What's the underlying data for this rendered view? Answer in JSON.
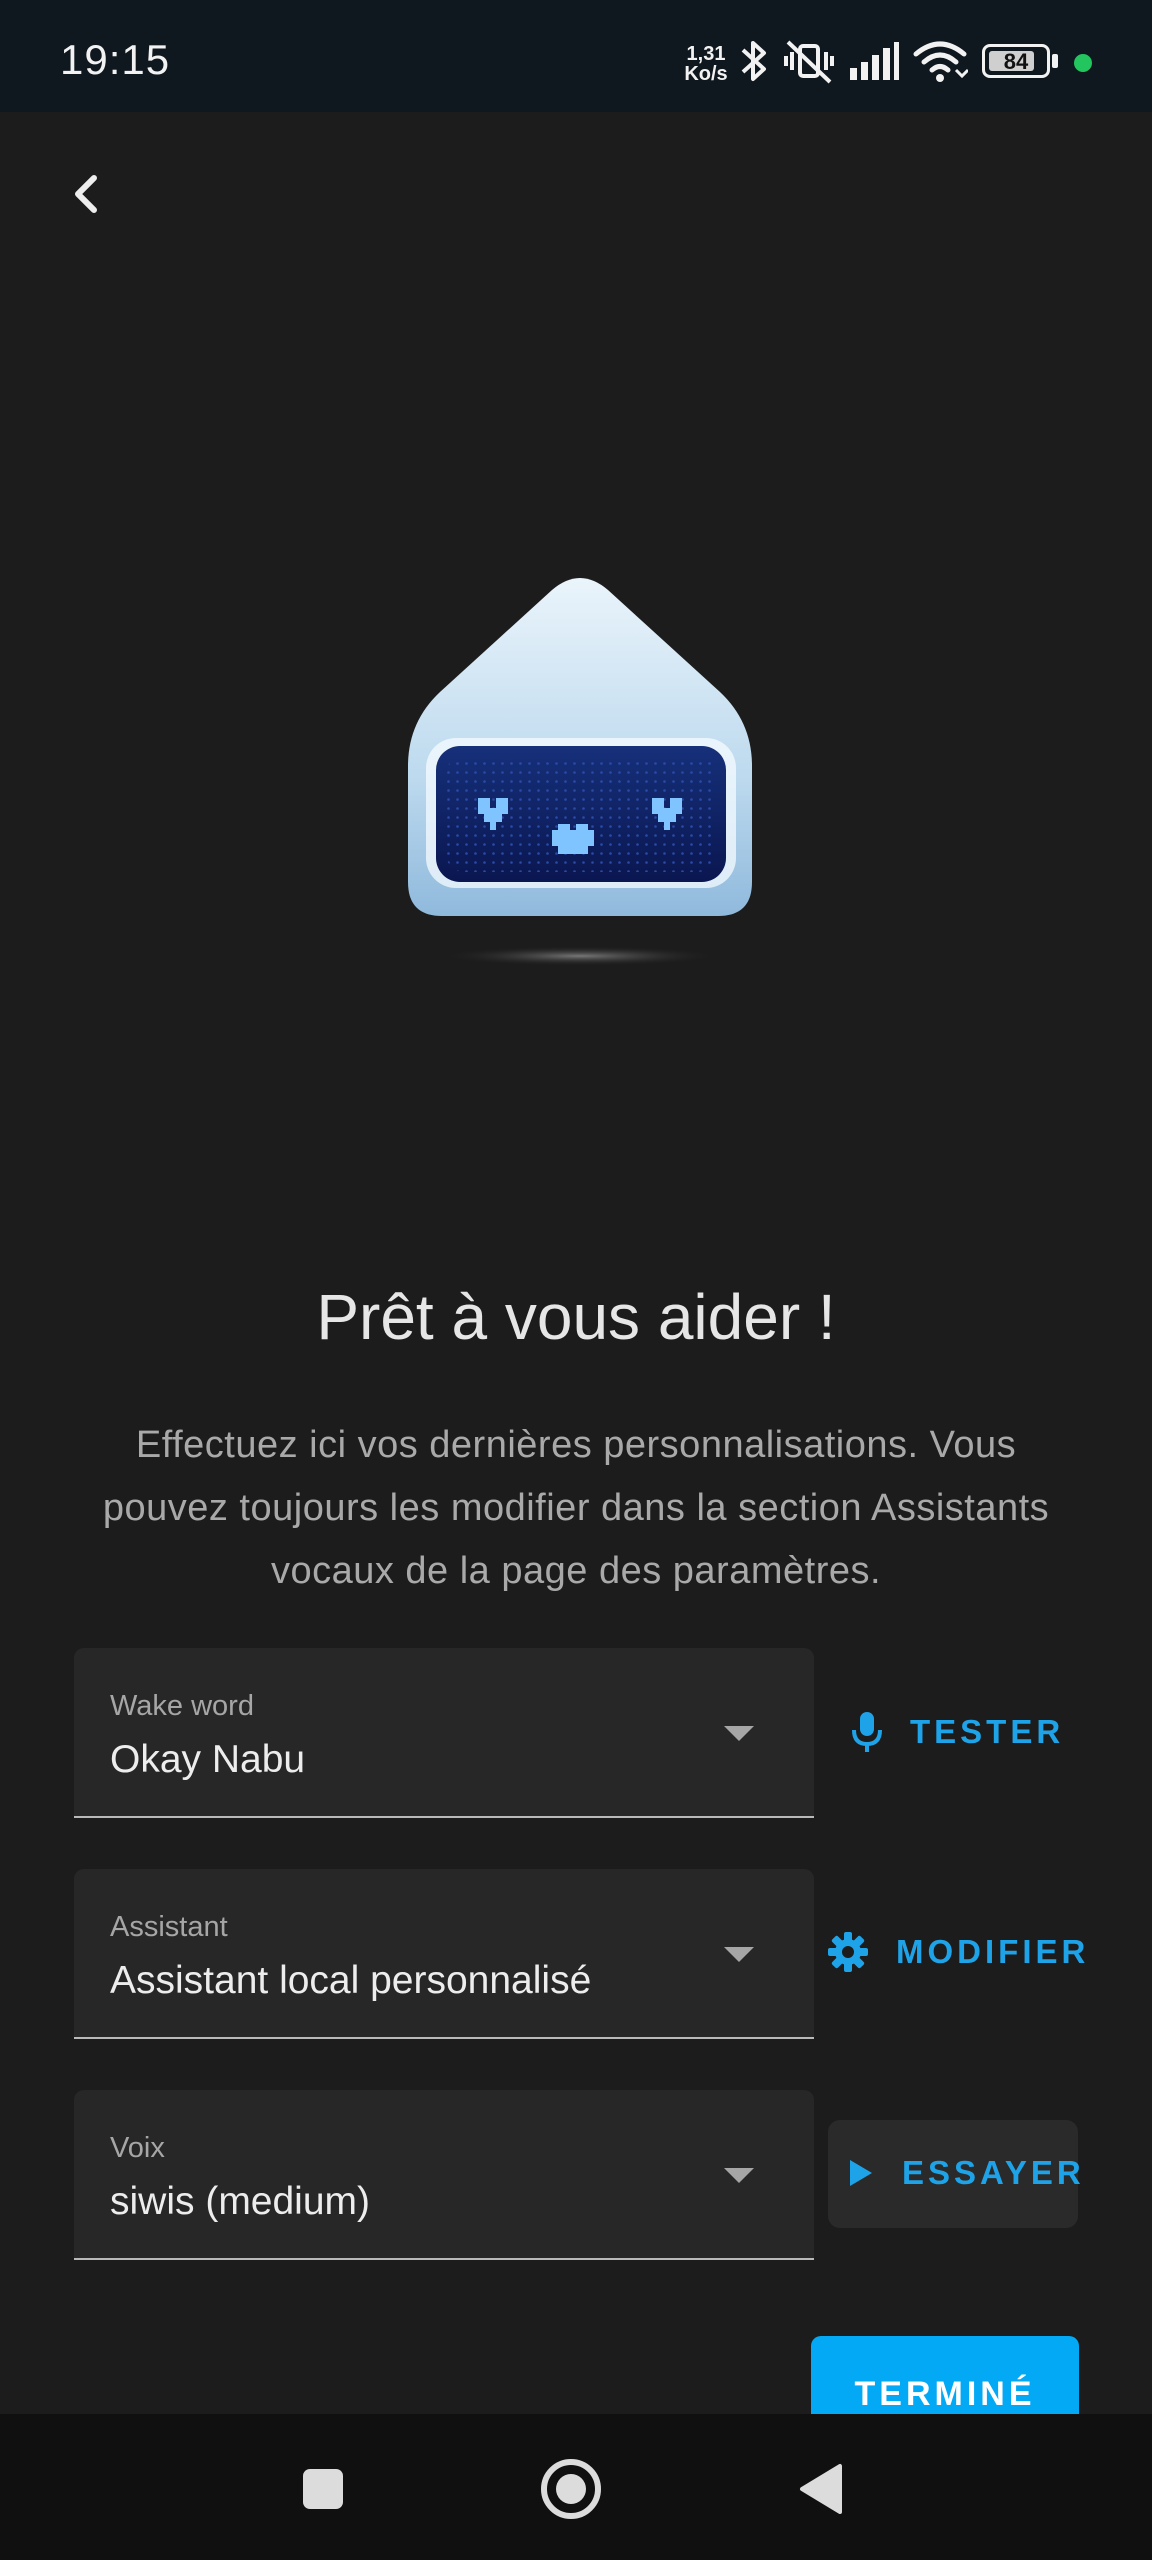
{
  "status_bar": {
    "time": "19:15",
    "net_speed_value": "1,31",
    "net_speed_unit": "Ko/s",
    "battery_level": "84",
    "battery_fraction": 0.84,
    "icons": [
      "bluetooth-icon",
      "vibrate-off-icon",
      "signal-icon",
      "wifi-icon",
      "battery-icon",
      "privacy-dot"
    ]
  },
  "header": {
    "back_icon": "chevron-left-icon"
  },
  "hero": {
    "image": "robot-mascot",
    "title": "Prêt à vous aider !"
  },
  "description": "Effectuez ici vos dernières personnalisations. Vous pouvez toujours les modifier dans la section Assistants vocaux de la page des paramètres.",
  "fields": {
    "wake_word": {
      "label": "Wake word",
      "value": "Okay Nabu"
    },
    "assistant": {
      "label": "Assistant",
      "value": "Assistant local personnalisé"
    },
    "voice": {
      "label": "Voix",
      "value": "siwis (medium)"
    }
  },
  "actions": {
    "test": {
      "label": "TESTER",
      "icon": "microphone-icon"
    },
    "modify": {
      "label": "MODIFIER",
      "icon": "gear-icon"
    },
    "try": {
      "label": "ESSAYER",
      "icon": "play-icon"
    },
    "done": {
      "label": "TERMINÉ"
    }
  },
  "nav_bar": {
    "icons": [
      "recents-square-icon",
      "home-circle-icon",
      "back-triangle-icon"
    ]
  },
  "colors": {
    "background": "#1c1c1c",
    "accent": "#1fa3e8",
    "primary_button": "#03a9f4",
    "status_bar": "#0f171f",
    "privacy_dot": "#22c55e"
  }
}
